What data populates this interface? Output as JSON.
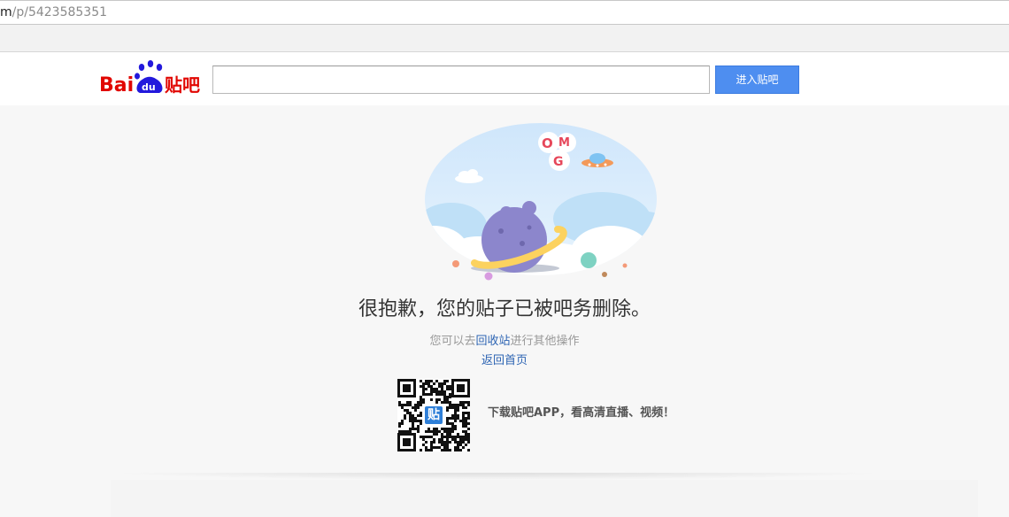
{
  "browser": {
    "address_prefix": "m",
    "address_path": "/p/5423585351"
  },
  "header": {
    "logo_alt": "Bai du 贴吧",
    "search_placeholder": "",
    "search_button_label": "进入贴吧"
  },
  "message": {
    "title": "很抱歉，您的贴子已被吧务删除。",
    "sub_prefix": "您可以去",
    "recycle_link": "回收站",
    "sub_suffix": "进行其他操作",
    "home_link": "返回首页"
  },
  "app_promo": {
    "qr_badge": "贴",
    "text": "下载贴吧APP，看高清直播、视频！"
  },
  "illustration": {
    "badge_text": "OMG"
  },
  "colors": {
    "accent_blue": "#4e8ef0",
    "link_blue": "#2d64b3",
    "baidu_red": "#e10601",
    "baidu_blue": "#2319dc"
  }
}
